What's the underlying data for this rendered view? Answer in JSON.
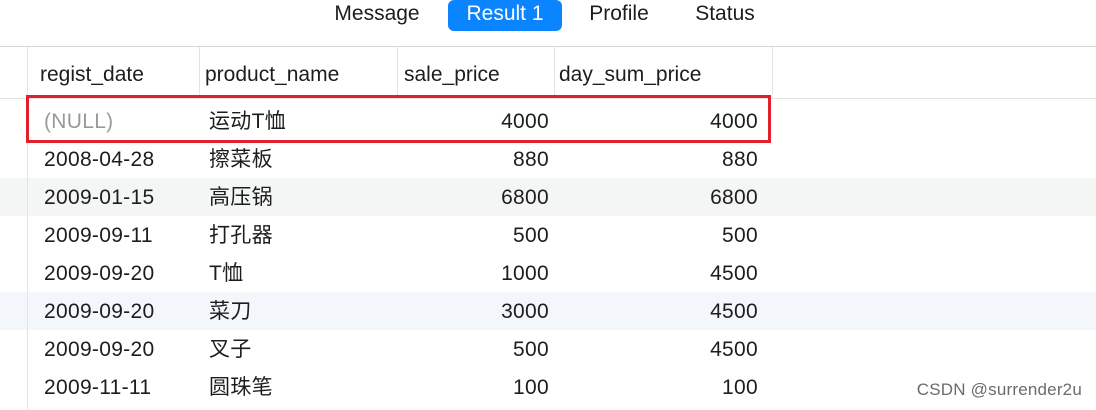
{
  "tabs": [
    {
      "label": "Message",
      "active": false
    },
    {
      "label": "Result 1",
      "active": true
    },
    {
      "label": "Profile",
      "active": false
    },
    {
      "label": "Status",
      "active": false
    }
  ],
  "table": {
    "columns": [
      "regist_date",
      "product_name",
      "sale_price",
      "day_sum_price"
    ],
    "rows": [
      [
        "(NULL)",
        "运动T恤",
        "4000",
        "4000"
      ],
      [
        "2008-04-28",
        "擦菜板",
        "880",
        "880"
      ],
      [
        "2009-01-15",
        "高压锅",
        "6800",
        "6800"
      ],
      [
        "2009-09-11",
        "打孔器",
        "500",
        "500"
      ],
      [
        "2009-09-20",
        "T恤",
        "1000",
        "4500"
      ],
      [
        "2009-09-20",
        "菜刀",
        "3000",
        "4500"
      ],
      [
        "2009-09-20",
        "叉子",
        "500",
        "4500"
      ],
      [
        "2009-11-11",
        "圆珠笔",
        "100",
        "100"
      ]
    ]
  },
  "highlight": {
    "row_index": 0,
    "color": "#e0202a"
  },
  "colors": {
    "accent": "#0a84ff",
    "null_text": "#9a9a9a"
  },
  "watermark": "CSDN @surrender2u"
}
